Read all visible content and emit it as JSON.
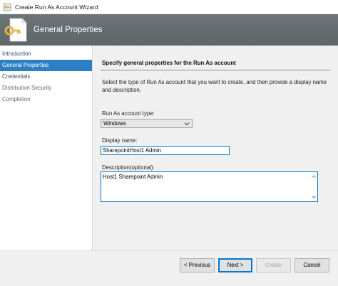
{
  "window": {
    "title": "Create Run As Account Wizard"
  },
  "header": {
    "title": "General Properties"
  },
  "sidebar": {
    "items": [
      {
        "label": "Introduction",
        "state": "normal"
      },
      {
        "label": "General Properties",
        "state": "active"
      },
      {
        "label": "Credentials",
        "state": "normal"
      },
      {
        "label": "Distribution Security",
        "state": "disabled"
      },
      {
        "label": "Completion",
        "state": "disabled"
      }
    ]
  },
  "main": {
    "section_title": "Specify general properties for the Run As account",
    "description": "Select the type of Run As account that you want to create, and then provide a display name and description.",
    "account_type_label": "Run As account type:",
    "account_type_value": "Windows",
    "display_name_label": "Display name:",
    "display_name_value": "SharepointHost1 Admin",
    "description_label": "Description(optional):",
    "description_value": "Host1 Sharepoint Admin"
  },
  "footer": {
    "previous_label": "< Previous",
    "next_label": "Next >",
    "create_label": "Create",
    "cancel_label": "Cancel"
  },
  "colors": {
    "header_bg": "#636b6f",
    "active_nav": "#2c7fc5",
    "focus_border": "#0078d7"
  }
}
